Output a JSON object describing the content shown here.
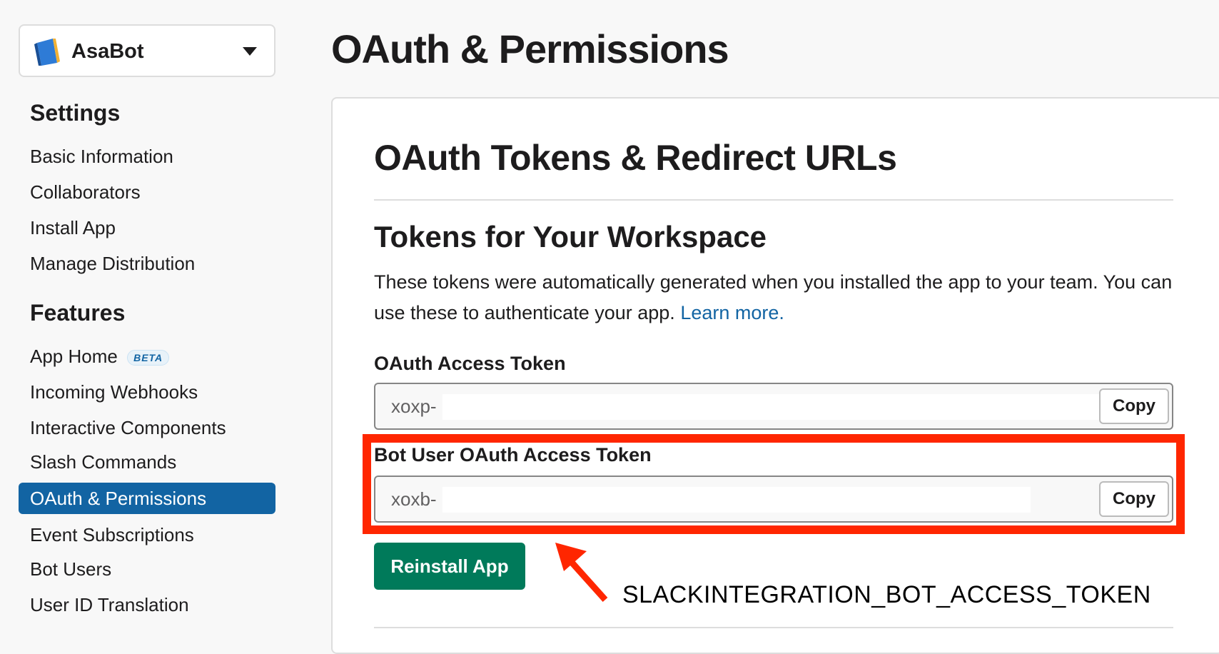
{
  "app_switcher": {
    "name": "AsaBot",
    "icon": "book-icon"
  },
  "sidebar": {
    "settings_heading": "Settings",
    "settings_items": [
      {
        "label": "Basic Information"
      },
      {
        "label": "Collaborators"
      },
      {
        "label": "Install App"
      },
      {
        "label": "Manage Distribution"
      }
    ],
    "features_heading": "Features",
    "features_items": [
      {
        "label": "App Home",
        "badge": "BETA"
      },
      {
        "label": "Incoming Webhooks"
      },
      {
        "label": "Interactive Components"
      },
      {
        "label": "Slash Commands"
      },
      {
        "label": "OAuth & Permissions",
        "active": true
      },
      {
        "label": "Event Subscriptions"
      },
      {
        "label": "Bot Users"
      },
      {
        "label": "User ID Translation"
      }
    ]
  },
  "page": {
    "title": "OAuth & Permissions"
  },
  "card": {
    "section_title": "OAuth Tokens & Redirect URLs",
    "sub_title": "Tokens for Your Workspace",
    "description": "These tokens were automatically generated when you installed the app to your team. You can use these to authenticate your app.",
    "learn_more": "Learn more.",
    "oauth_token": {
      "label": "OAuth Access Token",
      "value": "xoxp-",
      "copy_label": "Copy"
    },
    "bot_token": {
      "label": "Bot User OAuth Access Token",
      "value": "xoxb-",
      "copy_label": "Copy"
    },
    "reinstall_label": "Reinstall App"
  },
  "annotation": {
    "text": "SLACKINTEGRATION_BOT_ACCESS_TOKEN",
    "color": "#ff2600"
  },
  "colors": {
    "active_nav": "#1264a3",
    "primary_button": "#007a5a",
    "link": "#1264a3",
    "highlight": "#ff2600"
  }
}
